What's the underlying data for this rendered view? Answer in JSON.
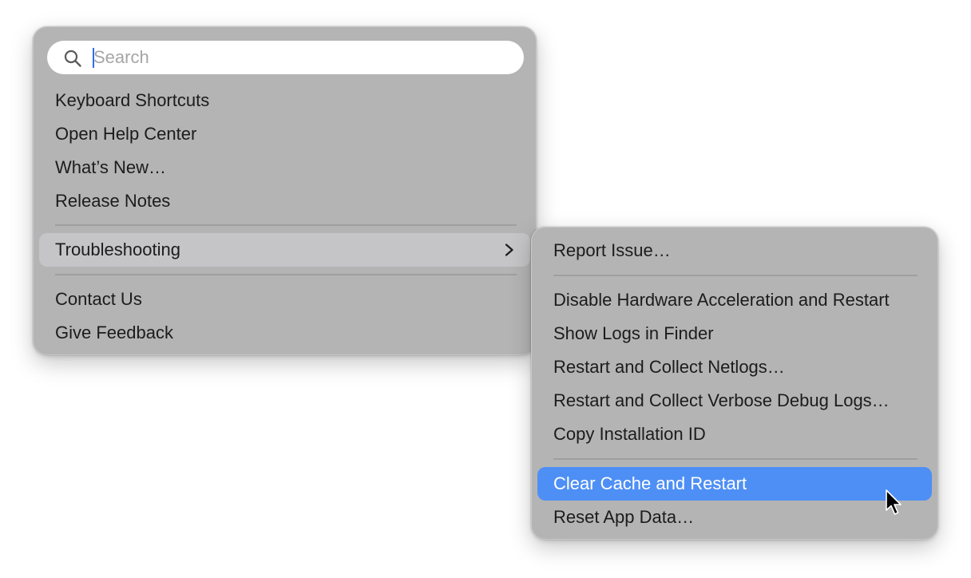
{
  "search": {
    "placeholder": "Search",
    "icon": "magnifying-glass"
  },
  "main_menu": {
    "items_group1": [
      {
        "label": "Keyboard Shortcuts"
      },
      {
        "label": "Open Help Center"
      },
      {
        "label": "What’s New…"
      },
      {
        "label": "Release Notes"
      }
    ],
    "troubleshooting": {
      "label": "Troubleshooting",
      "icon": "chevron-right"
    },
    "items_group3": [
      {
        "label": "Contact Us"
      },
      {
        "label": "Give Feedback"
      }
    ]
  },
  "sub_menu": {
    "items_group1": [
      {
        "label": "Report Issue…"
      }
    ],
    "items_group2": [
      {
        "label": "Disable Hardware Acceleration and Restart"
      },
      {
        "label": "Show Logs in Finder"
      },
      {
        "label": "Restart and Collect Netlogs…"
      },
      {
        "label": "Restart and Collect Verbose Debug Logs…"
      },
      {
        "label": "Copy Installation ID"
      }
    ],
    "items_group3": [
      {
        "label": "Clear Cache and Restart",
        "selected": true
      },
      {
        "label": "Reset App Data…"
      }
    ]
  },
  "colors": {
    "menu_background": "#b4b4b4",
    "selection_accent": "#4e8ff5",
    "hover_background": "#c5c5c7",
    "caret": "#2f6df2"
  }
}
